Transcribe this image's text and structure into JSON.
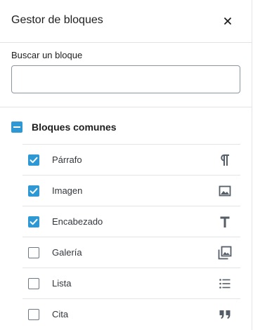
{
  "header": {
    "title": "Gestor de bloques",
    "close_icon": "close-icon"
  },
  "search": {
    "label": "Buscar un bloque",
    "value": "",
    "placeholder": ""
  },
  "category": {
    "label": "Bloques comunes",
    "state": "indeterminate"
  },
  "blocks": [
    {
      "label": "Párrafo",
      "checked": true,
      "icon": "paragraph-icon"
    },
    {
      "label": "Imagen",
      "checked": true,
      "icon": "image-icon"
    },
    {
      "label": "Encabezado",
      "checked": true,
      "icon": "heading-icon"
    },
    {
      "label": "Galería",
      "checked": false,
      "icon": "gallery-icon"
    },
    {
      "label": "Lista",
      "checked": false,
      "icon": "list-icon"
    },
    {
      "label": "Cita",
      "checked": false,
      "icon": "quote-icon"
    }
  ],
  "colors": {
    "accent": "#2e98d5",
    "border": "#e2e4e7",
    "text": "#1e1e1e",
    "icon": "#555d66"
  }
}
